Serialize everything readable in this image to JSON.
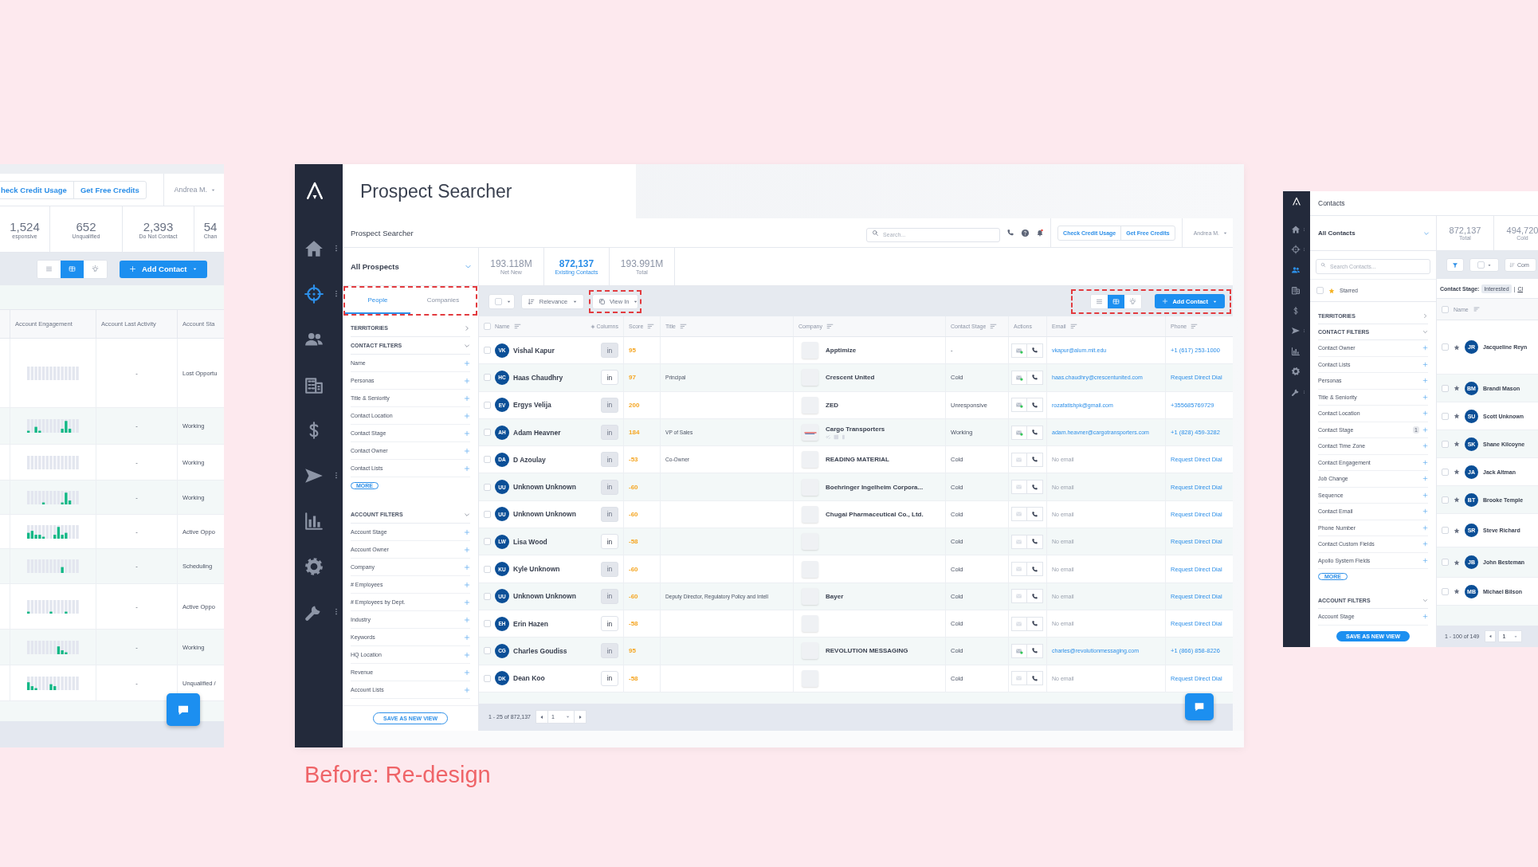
{
  "caption": "Before: Re-design",
  "left_panel": {
    "header_buttons": [
      "heck Credit Usage",
      "Get Free Credits"
    ],
    "user": "Andrea M.",
    "stats": [
      {
        "value": "1,524",
        "label": "esponsive"
      },
      {
        "value": "652",
        "label": "Unqualified"
      },
      {
        "value": "2,393",
        "label": "Do Not Contact"
      },
      {
        "value": "54",
        "label": "Chan"
      }
    ],
    "views": [
      {
        "kind": "list",
        "selected": false
      },
      {
        "kind": "table",
        "selected": true
      },
      {
        "kind": "bulb",
        "selected": false
      }
    ],
    "add_button": "Add Contact",
    "columns": [
      "Account Engagement",
      "Account Last Activity",
      "Account Sta"
    ],
    "rows": [
      {
        "last_activity": "-",
        "stage": "Lost Opportu"
      },
      {
        "last_activity": "-",
        "stage": "Working"
      },
      {
        "last_activity": "-",
        "stage": "Working"
      },
      {
        "last_activity": "-",
        "stage": "Working"
      },
      {
        "last_activity": "-",
        "stage": "Active Oppo"
      },
      {
        "last_activity": "-",
        "stage": "Scheduling"
      },
      {
        "last_activity": "-",
        "stage": "Active Oppo"
      },
      {
        "last_activity": "-",
        "stage": "Working"
      },
      {
        "last_activity": "-",
        "stage": "Unqualified /"
      }
    ]
  },
  "main": {
    "page_title": "Prospect Searcher",
    "nav": [
      {
        "kind": "home",
        "selected": false,
        "menu": true
      },
      {
        "kind": "crosshair",
        "selected": true,
        "menu": true
      },
      {
        "kind": "people",
        "selected": false,
        "menu": false
      },
      {
        "kind": "building",
        "selected": false,
        "menu": false
      },
      {
        "kind": "dollar",
        "selected": false,
        "menu": false
      },
      {
        "kind": "send",
        "selected": false,
        "menu": true
      },
      {
        "kind": "chart",
        "selected": false,
        "menu": false
      },
      {
        "kind": "gear",
        "selected": false,
        "menu": false
      },
      {
        "kind": "wrench",
        "selected": false,
        "menu": true
      }
    ],
    "header": {
      "title": "Prospect Searcher",
      "search_placeholder": "Search...",
      "buttons": [
        "Check Credit Usage",
        "Get Free Credits"
      ],
      "user": "Andrea M."
    },
    "filters": {
      "view": "All Prospects",
      "tabs": [
        {
          "label": "People",
          "selected": true
        },
        {
          "label": "Companies",
          "selected": false
        }
      ],
      "sections": [
        {
          "title": "TERRITORIES",
          "expanded": false
        },
        {
          "title": "CONTACT FILTERS",
          "expanded": true,
          "items": [
            "Name",
            "Personas",
            "Title & Seniority",
            "Contact Location",
            "Contact Stage",
            "Contact Owner",
            "Contact Lists"
          ],
          "more": "MORE"
        },
        {
          "title": "ACCOUNT FILTERS",
          "expanded": true,
          "items": [
            "Account Stage",
            "Account Owner",
            "Company",
            "# Employees",
            "# Employees by Dept.",
            "Industry",
            "Keywords",
            "HQ Location",
            "Revenue",
            "Account Lists"
          ]
        }
      ],
      "save": "SAVE AS NEW VIEW"
    },
    "stats": [
      {
        "value": "193.118M",
        "label": "Net New",
        "selected": false
      },
      {
        "value": "872,137",
        "label": "Existing Contacts",
        "selected": true
      },
      {
        "value": "193.991M",
        "label": "Total",
        "selected": false
      }
    ],
    "toolbar": {
      "sort": "Relevance",
      "view_in": "View In",
      "views": [
        {
          "kind": "list",
          "selected": false
        },
        {
          "kind": "table",
          "selected": true
        },
        {
          "kind": "bulb",
          "selected": false
        }
      ],
      "add": "Add Contact"
    },
    "columns": {
      "all_checked": false,
      "name": "Name",
      "columns_button": "Columns",
      "score": "Score",
      "title": "Title",
      "company": "Company",
      "stage": "Contact Stage",
      "actions": "Actions",
      "email": "Email",
      "phone": "Phone"
    },
    "rows": [
      {
        "checked": false,
        "initials": "VK",
        "name": "Vishal Kapur",
        "li": "in",
        "li_active": false,
        "score": "95",
        "company": "Apptimize",
        "stage": "-",
        "has_email": true,
        "email": "vkapur@alum.mit.edu",
        "phone": "+1 (617) 253-1000"
      },
      {
        "checked": false,
        "initials": "HC",
        "name": "Haas Chaudhry",
        "li": "in",
        "li_active": true,
        "score": "97",
        "title": "Principal",
        "company": "Crescent United",
        "stage": "Cold",
        "has_email": true,
        "email": "haas.chaudhry@crescentunited.com",
        "phone": "Request Direct Dial"
      },
      {
        "checked": false,
        "initials": "EV",
        "name": "Ergys Velija",
        "li": "in",
        "li_active": false,
        "score": "200",
        "company": "ZED",
        "stage": "Unresponsive",
        "has_email": true,
        "email": "rozafatishpk@gmail.com",
        "phone": "+355685769729"
      },
      {
        "checked": false,
        "initials": "AH",
        "name": "Adam Heavner",
        "li": "in",
        "li_active": false,
        "score": "184",
        "title": "VP of Sales",
        "company": "Cargo Transporters",
        "logo": true,
        "stage": "Working",
        "has_email": true,
        "email": "adam.heavner@cargotransporters.com",
        "phone": "+1 (828) 459-3282"
      },
      {
        "checked": false,
        "initials": "DA",
        "name": "D Azoulay",
        "li": "in",
        "li_active": false,
        "score": "-53",
        "title": "Co-Owner",
        "company": "READING MATERIAL",
        "stage": "Cold",
        "has_email": false,
        "email": "No email",
        "phone": "Request Direct Dial"
      },
      {
        "checked": false,
        "initials": "UU",
        "name": "Unknown Unknown",
        "li": "in",
        "li_active": false,
        "score": "-60",
        "company": "Boehringer Ingelheim Corpora...",
        "stage": "Cold",
        "has_email": false,
        "email": "No email",
        "phone": "Request Direct Dial"
      },
      {
        "checked": false,
        "initials": "UU",
        "name": "Unknown Unknown",
        "li": "in",
        "li_active": false,
        "score": "-60",
        "company": "Chugai Pharmaceutical Co., Ltd.",
        "stage": "Cold",
        "has_email": false,
        "email": "No email",
        "phone": "Request Direct Dial"
      },
      {
        "checked": false,
        "initials": "LW",
        "name": "Lisa Wood",
        "li": "in",
        "li_active": true,
        "score": "-58",
        "stage": "Cold",
        "has_email": false,
        "email": "No email",
        "phone": "Request Direct Dial"
      },
      {
        "checked": false,
        "initials": "KU",
        "name": "Kyle Unknown",
        "li": "in",
        "li_active": false,
        "score": "-60",
        "stage": "Cold",
        "has_email": false,
        "email": "No email",
        "phone": "Request Direct Dial"
      },
      {
        "checked": false,
        "initials": "UU",
        "name": "Unknown Unknown",
        "li": "in",
        "li_active": false,
        "score": "-60",
        "title": "Deputy Director, Regulatory Policy and Intell",
        "company": "Bayer",
        "stage": "Cold",
        "has_email": false,
        "email": "No email",
        "phone": "Request Direct Dial"
      },
      {
        "checked": false,
        "initials": "EH",
        "name": "Erin Hazen",
        "li": "in",
        "li_active": true,
        "score": "-58",
        "stage": "Cold",
        "has_email": false,
        "email": "No email",
        "phone": "Request Direct Dial"
      },
      {
        "checked": false,
        "initials": "CG",
        "name": "Charles Goudiss",
        "li": "in",
        "li_active": false,
        "score": "95",
        "company": "REVOLUTION MESSAGING",
        "stage": "Cold",
        "has_email": true,
        "email": "charles@revolutionmessaging.com",
        "phone": "+1 (866) 858-8226"
      },
      {
        "checked": false,
        "initials": "DK",
        "name": "Dean Koo",
        "li": "in",
        "li_active": true,
        "score": "-58",
        "stage": "Cold",
        "has_email": false,
        "email": "No email",
        "phone": "Request Direct Dial"
      }
    ],
    "pagination": {
      "range": "1 - 25 of 872,137",
      "page": "1"
    }
  },
  "right_panel": {
    "title": "Contacts",
    "nav": [
      {
        "kind": "home",
        "selected": false,
        "menu": true
      },
      {
        "kind": "crosshair",
        "selected": false,
        "menu": true
      },
      {
        "kind": "people",
        "selected": true,
        "menu": false
      },
      {
        "kind": "building",
        "selected": false,
        "menu": false
      },
      {
        "kind": "dollar",
        "selected": false,
        "menu": false
      },
      {
        "kind": "send",
        "selected": false,
        "menu": true
      },
      {
        "kind": "chart",
        "selected": false,
        "menu": false
      },
      {
        "kind": "gear",
        "selected": false,
        "menu": false
      },
      {
        "kind": "wrench",
        "selected": false,
        "menu": true
      }
    ],
    "view": "All Contacts",
    "search_placeholder": "Search Contacts...",
    "starred": "Starred",
    "starred_checked": false,
    "sections": [
      {
        "title": "TERRITORIES",
        "expanded": false
      },
      {
        "title": "CONTACT FILTERS",
        "expanded": true,
        "items": [
          {
            "label": "Contact Owner"
          },
          {
            "label": "Contact Lists"
          },
          {
            "label": "Personas"
          },
          {
            "label": "Title & Seniority"
          },
          {
            "label": "Contact Location"
          },
          {
            "label": "Contact Stage",
            "count": "1"
          },
          {
            "label": "Contact Time Zone"
          },
          {
            "label": "Contact Engagement"
          },
          {
            "label": "Job Change"
          },
          {
            "label": "Sequence"
          },
          {
            "label": "Contact Email"
          },
          {
            "label": "Phone Number"
          },
          {
            "label": "Contact Custom Fields"
          },
          {
            "label": "Apollo System Fields"
          }
        ],
        "more": "MORE"
      },
      {
        "title": "ACCOUNT FILTERS",
        "expanded": true,
        "items": [
          {
            "label": "Account Stage"
          }
        ]
      }
    ],
    "save": "SAVE AS NEW VIEW",
    "stats": [
      {
        "value": "872,137",
        "label": "Total"
      },
      {
        "value": "494,720",
        "label": "Cold"
      }
    ],
    "sort": "Com",
    "chip_label": "Contact Stage:",
    "chip": "Interested",
    "chip_sep": "|",
    "chip_more": "Cl",
    "all_checked": false,
    "name_column": "Name",
    "rows": [
      {
        "checked": false,
        "initials": "JR",
        "name": "Jacqueline Reyn"
      },
      {
        "checked": false,
        "initials": "BM",
        "name": "Brandi Mason"
      },
      {
        "checked": false,
        "initials": "SU",
        "name": "Scott Unknown"
      },
      {
        "checked": false,
        "initials": "SK",
        "name": "Shane Kilcoyne"
      },
      {
        "checked": false,
        "initials": "JA",
        "name": "Jack Altman"
      },
      {
        "checked": false,
        "initials": "BT",
        "name": "Brooke Temple"
      },
      {
        "checked": false,
        "initials": "SR",
        "name": "Steve Richard"
      },
      {
        "checked": false,
        "initials": "JB",
        "name": "John Besteman"
      },
      {
        "checked": false,
        "initials": "MB",
        "name": "Michael Bilson"
      }
    ],
    "pagination": {
      "range": "1 - 100 of 149",
      "page": "1"
    }
  }
}
